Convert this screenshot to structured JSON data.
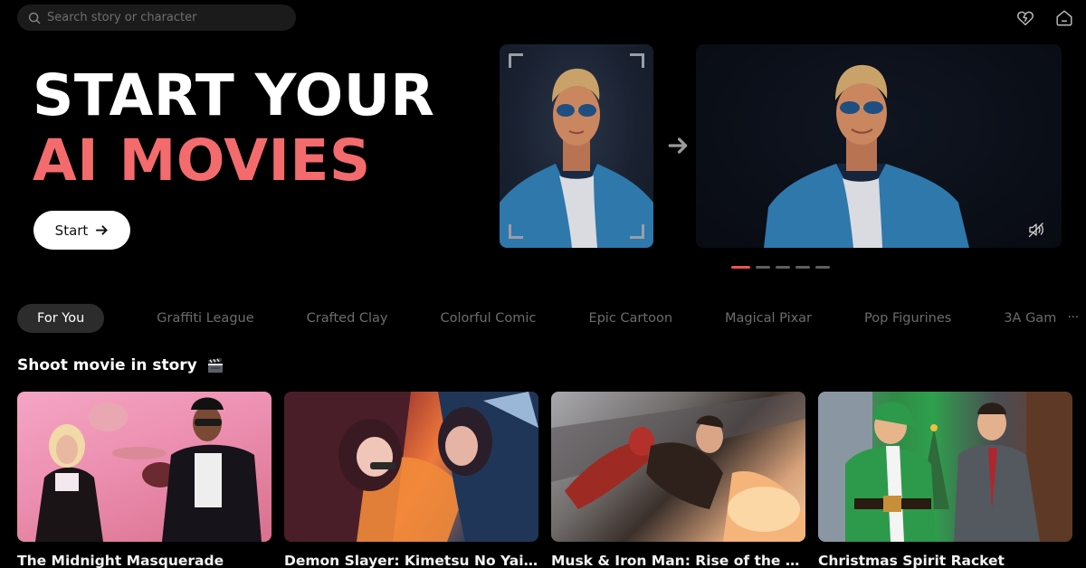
{
  "search": {
    "placeholder": "Search story or character",
    "value": ""
  },
  "top_icons": [
    {
      "name": "favorites-heart-icon"
    },
    {
      "name": "home-icon"
    }
  ],
  "hero": {
    "title_line1": "START YOUR",
    "title_line2": "AI MOVIES",
    "start_label": "Start",
    "accent_color": "#f46b6e"
  },
  "carousel": {
    "slide_count": 5,
    "active_index": 0,
    "active_color": "#f1514f"
  },
  "tabs": [
    {
      "label": "For You",
      "active": true
    },
    {
      "label": "Graffiti League",
      "active": false
    },
    {
      "label": "Crafted Clay",
      "active": false
    },
    {
      "label": "Colorful Comic",
      "active": false
    },
    {
      "label": "Epic Cartoon",
      "active": false
    },
    {
      "label": "Magical Pixar",
      "active": false
    },
    {
      "label": "Pop Figurines",
      "active": false
    },
    {
      "label": "3A Gam",
      "active": false
    }
  ],
  "tabs_more": "···",
  "section": {
    "title": "Shoot movie in story",
    "icon": "clapperboard-icon"
  },
  "cards": [
    {
      "title": "The Midnight Masquerade"
    },
    {
      "title": "Demon Slayer: Kimetsu No Yaiba"
    },
    {
      "title": "Musk & Iron Man: Rise of the Machines"
    },
    {
      "title": "Christmas Spirit Racket"
    }
  ]
}
